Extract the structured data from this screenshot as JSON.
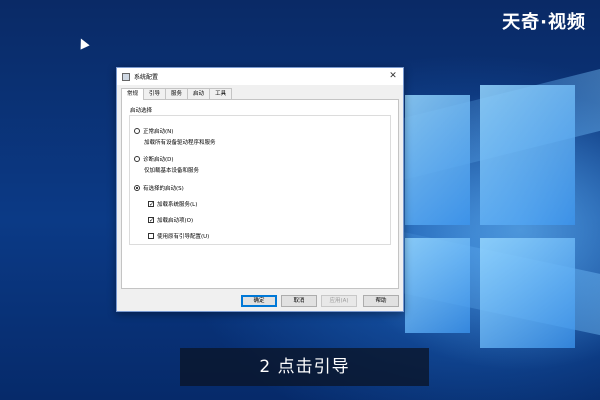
{
  "watermark": {
    "brand": "天奇·视频"
  },
  "dialog": {
    "title": "系统配置",
    "close_glyph": "✕",
    "tabs": [
      {
        "label": "常规",
        "active": true
      },
      {
        "label": "引导",
        "active": false
      },
      {
        "label": "服务",
        "active": false
      },
      {
        "label": "启动",
        "active": false
      },
      {
        "label": "工具",
        "active": false
      }
    ],
    "group_title": "启动选择",
    "options": {
      "normal": {
        "label": "正常启动(N)",
        "desc": "加载所有设备驱动程序和服务",
        "selected": false
      },
      "diagnostic": {
        "label": "诊断启动(D)",
        "desc": "仅加载基本设备和服务",
        "selected": false
      },
      "selective": {
        "label": "有选择的启动(S)",
        "selected": true
      }
    },
    "checkboxes": [
      {
        "label": "加载系统服务(L)",
        "checked": true
      },
      {
        "label": "加载启动项(O)",
        "checked": true
      },
      {
        "label": "使用原有引导配置(U)",
        "checked": false
      }
    ],
    "buttons": {
      "ok": "确定",
      "cancel": "取消",
      "apply": "应用(A)",
      "help": "帮助"
    }
  },
  "caption": {
    "text": "2 点击引导"
  },
  "colors": {
    "accent": "#0078d7",
    "desktop": "#0b3a86"
  }
}
